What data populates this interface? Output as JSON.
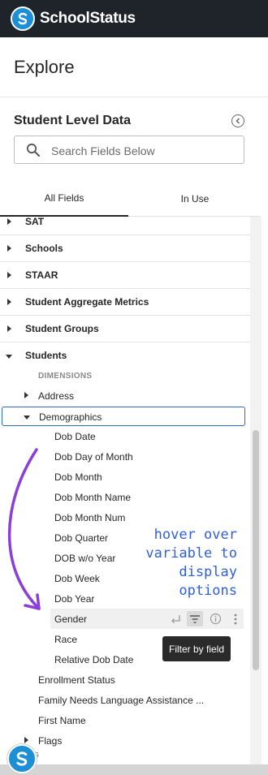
{
  "app": {
    "brand": "SchoolStatus"
  },
  "page": {
    "title": "Explore"
  },
  "panel": {
    "title": "Student Level Data",
    "search_placeholder": "Search Fields Below",
    "tabs": [
      "All Fields",
      "In Use"
    ]
  },
  "groups": [
    {
      "label": "SAT"
    },
    {
      "label": "Schools"
    },
    {
      "label": "STAAR"
    },
    {
      "label": "Student Aggregate Metrics"
    },
    {
      "label": "Student Groups"
    },
    {
      "label": "Students"
    }
  ],
  "students": {
    "dimensions_header": "DIMENSIONS",
    "address": "Address",
    "demographics": "Demographics",
    "demographics_fields": [
      "Dob Date",
      "Dob Day of Month",
      "Dob Month",
      "Dob Month Name",
      "Dob Month Num",
      "Dob Quarter",
      "DOB w/o Year",
      "Dob Week",
      "Dob Year",
      "Gender",
      "Race",
      "Relative Dob Date"
    ],
    "after_fields": [
      "Enrollment Status",
      "Family Needs Language Assistance ...",
      "First Name"
    ],
    "peek_group": "Flags",
    "peek_text": "lds"
  },
  "tooltip": "Filter by field",
  "annotation": [
    "hover over",
    "variable to",
    "display",
    "options"
  ],
  "colors": {
    "topbar": "#1e2429",
    "brand_blue": "#1d8fd6",
    "selected_outline": "#2b6cc4",
    "annotation": "#2f5fe0",
    "arrow": "#8a3fd6"
  }
}
